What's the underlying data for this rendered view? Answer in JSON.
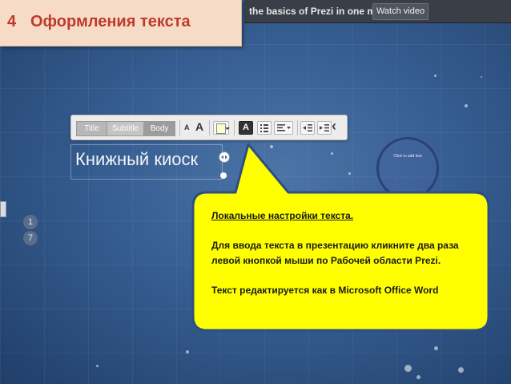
{
  "slide": {
    "number": "4",
    "title": "Оформления текста"
  },
  "prezi_bar": {
    "promo_text": "the basics of Prezi in one minute.",
    "watch_button": "Watch video"
  },
  "toolbar": {
    "style_tabs": [
      "Title",
      "Subtitle",
      "Body"
    ],
    "font_smaller_label": "A",
    "font_larger_label": "A",
    "text_color_label": "A",
    "collapse_label": "‹"
  },
  "canvas": {
    "text_object": "Книжный киоск",
    "circle_frame_title": "Click to add text",
    "path_steps": [
      "1",
      "7"
    ]
  },
  "callout": {
    "heading": "Локальные настройки текста.",
    "paragraph_1": "Для ввода текста в презентацию кликните два раза левой кнопкой мыши по Рабочей области Prezi.",
    "paragraph_2": "Текст редактируется как в Microsoft Office Word"
  },
  "colors": {
    "title_text": "#c0392b",
    "title_bg": "#f6dcc7",
    "callout_fill": "#ffff00",
    "callout_border": "#2c4f86",
    "canvas_bg": "#365d91"
  }
}
